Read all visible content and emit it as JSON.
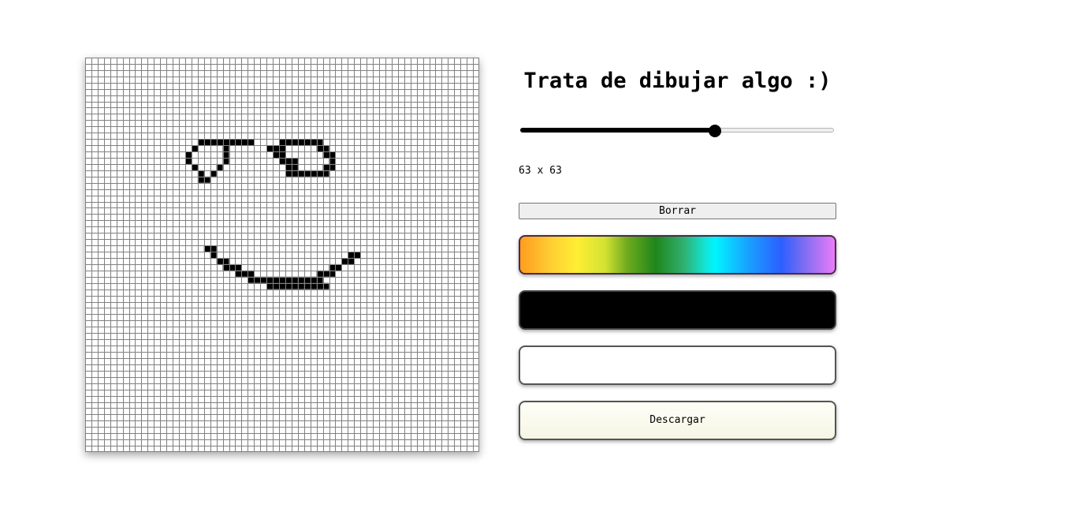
{
  "page": {
    "title": "Trata de dibujar algo :)"
  },
  "canvas": {
    "grid_size": 63,
    "grid_line_color": "#808080",
    "cell_color": "#ffffff",
    "paint_color": "#000000",
    "filled_cells": [
      [
        18,
        13
      ],
      [
        19,
        13
      ],
      [
        20,
        13
      ],
      [
        21,
        13
      ],
      [
        22,
        13
      ],
      [
        23,
        13
      ],
      [
        24,
        13
      ],
      [
        25,
        13
      ],
      [
        26,
        13
      ],
      [
        17,
        14
      ],
      [
        22,
        14
      ],
      [
        16,
        15
      ],
      [
        22,
        15
      ],
      [
        16,
        16
      ],
      [
        22,
        16
      ],
      [
        17,
        17
      ],
      [
        21,
        17
      ],
      [
        18,
        18
      ],
      [
        20,
        18
      ],
      [
        18,
        19
      ],
      [
        19,
        19
      ],
      [
        31,
        13
      ],
      [
        32,
        13
      ],
      [
        33,
        13
      ],
      [
        34,
        13
      ],
      [
        35,
        13
      ],
      [
        36,
        13
      ],
      [
        37,
        13
      ],
      [
        29,
        14
      ],
      [
        30,
        14
      ],
      [
        31,
        14
      ],
      [
        37,
        14
      ],
      [
        38,
        14
      ],
      [
        30,
        15
      ],
      [
        31,
        15
      ],
      [
        38,
        15
      ],
      [
        39,
        15
      ],
      [
        31,
        16
      ],
      [
        32,
        16
      ],
      [
        33,
        16
      ],
      [
        39,
        16
      ],
      [
        32,
        17
      ],
      [
        33,
        17
      ],
      [
        38,
        17
      ],
      [
        39,
        17
      ],
      [
        32,
        18
      ],
      [
        33,
        18
      ],
      [
        34,
        18
      ],
      [
        35,
        18
      ],
      [
        36,
        18
      ],
      [
        37,
        18
      ],
      [
        38,
        18
      ],
      [
        19,
        30
      ],
      [
        20,
        30
      ],
      [
        20,
        31
      ],
      [
        21,
        32
      ],
      [
        22,
        32
      ],
      [
        22,
        33
      ],
      [
        23,
        33
      ],
      [
        24,
        33
      ],
      [
        24,
        34
      ],
      [
        25,
        34
      ],
      [
        26,
        34
      ],
      [
        26,
        35
      ],
      [
        27,
        35
      ],
      [
        28,
        35
      ],
      [
        29,
        35
      ],
      [
        30,
        35
      ],
      [
        31,
        35
      ],
      [
        32,
        35
      ],
      [
        33,
        35
      ],
      [
        34,
        35
      ],
      [
        35,
        35
      ],
      [
        36,
        35
      ],
      [
        37,
        35
      ],
      [
        29,
        36
      ],
      [
        30,
        36
      ],
      [
        31,
        36
      ],
      [
        32,
        36
      ],
      [
        33,
        36
      ],
      [
        34,
        36
      ],
      [
        35,
        36
      ],
      [
        36,
        36
      ],
      [
        37,
        36
      ],
      [
        38,
        36
      ],
      [
        37,
        34
      ],
      [
        38,
        34
      ],
      [
        39,
        34
      ],
      [
        39,
        33
      ],
      [
        40,
        33
      ],
      [
        41,
        32
      ],
      [
        42,
        32
      ],
      [
        42,
        31
      ],
      [
        43,
        31
      ]
    ]
  },
  "controls": {
    "size_slider": {
      "min": 1,
      "max": 100,
      "value": 63
    },
    "size_label": "63 x 63",
    "clear_button_label": "Borrar",
    "rainbow_mode": {
      "colors": [
        "#ff9d1f",
        "#ffee33",
        "#1f861a",
        "#00f5ff",
        "#2c5fff",
        "#ea7cf8"
      ]
    },
    "black_color": "#000000",
    "white_color": "#ffffff",
    "download_button_label": "Descargar"
  }
}
